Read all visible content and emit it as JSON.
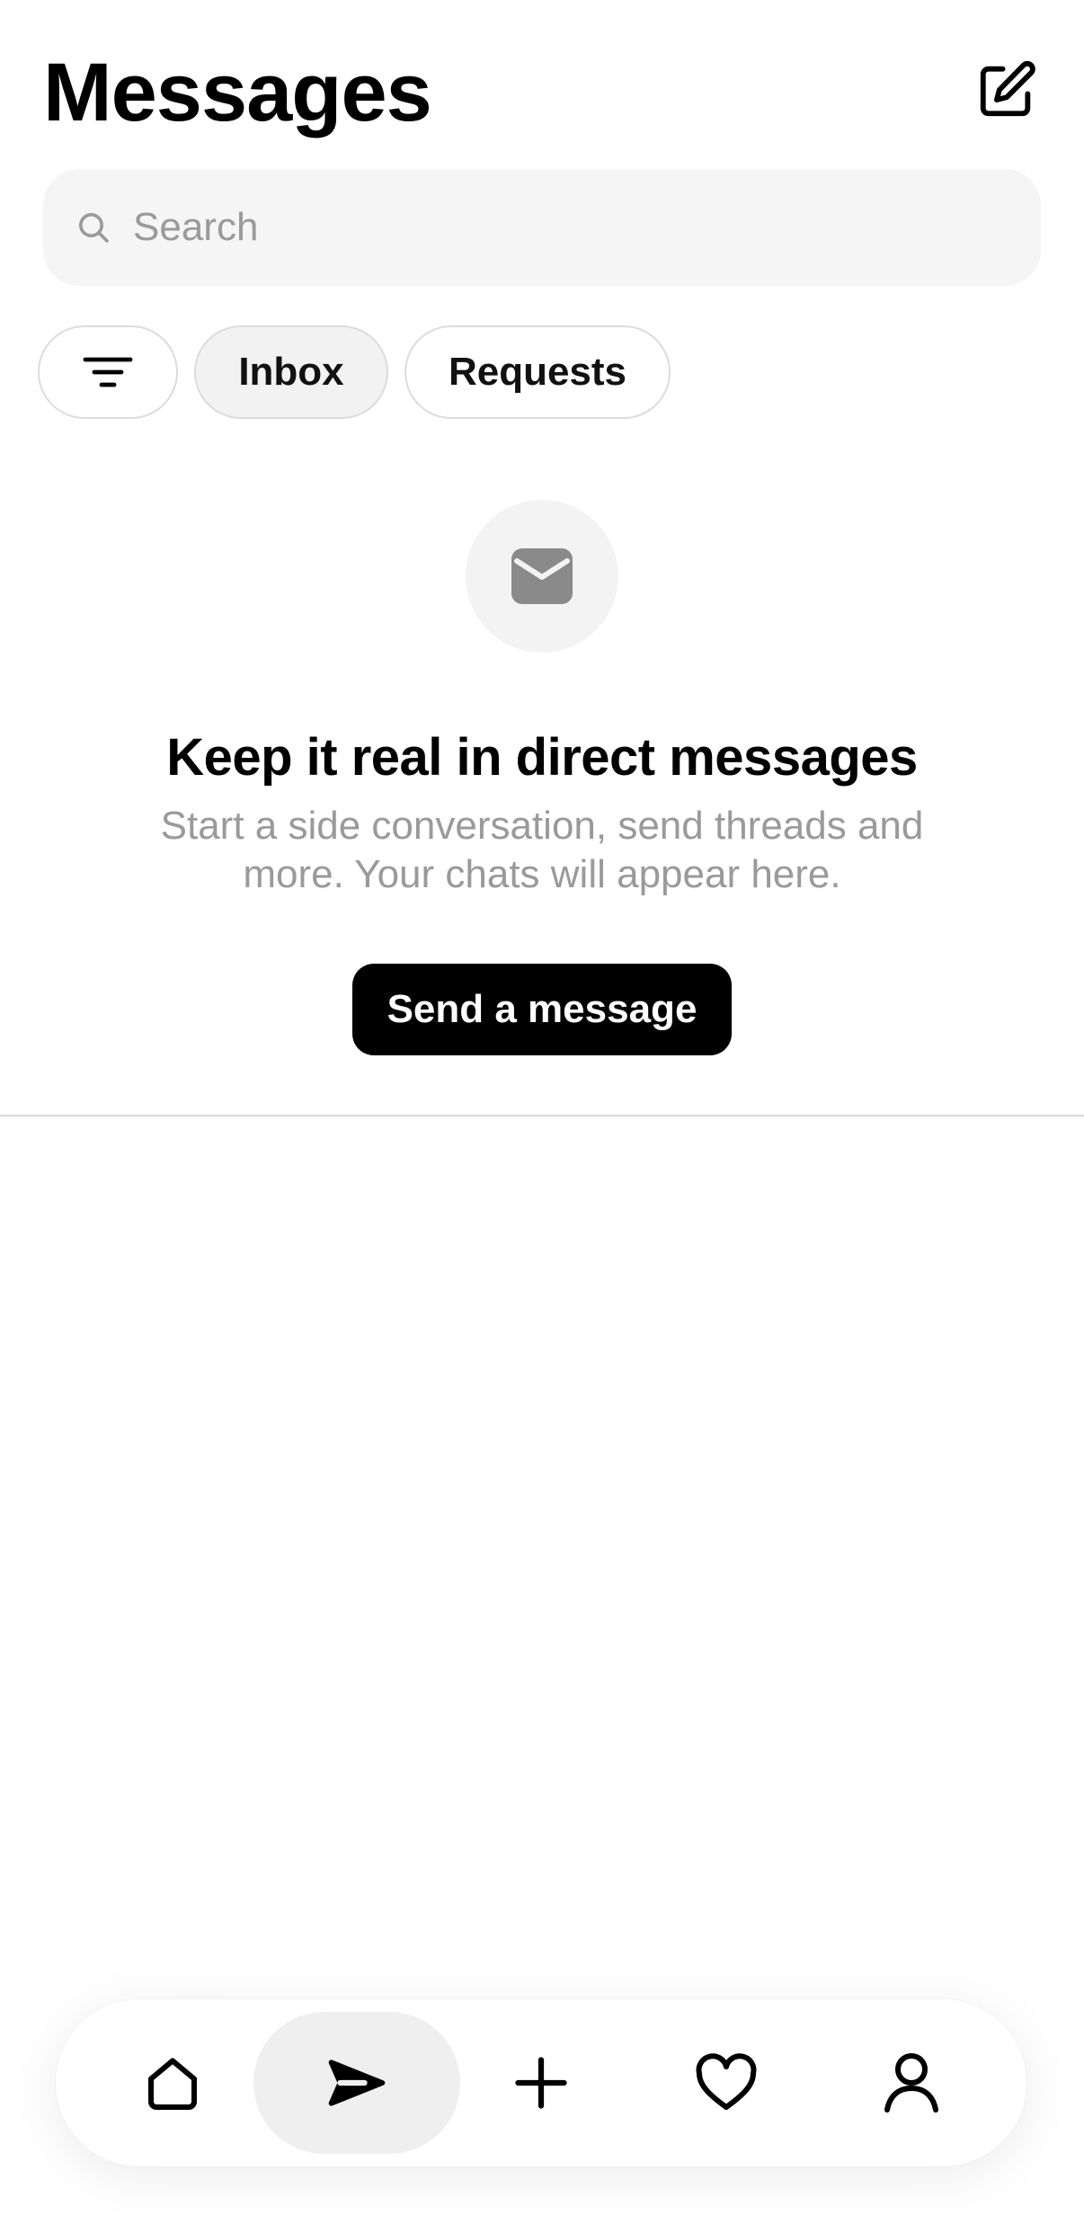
{
  "header": {
    "title": "Messages",
    "compose_icon": "compose-icon"
  },
  "search": {
    "placeholder": "Search",
    "value": "",
    "icon": "search-icon"
  },
  "filters": {
    "filter_icon": "filter-icon",
    "chips": [
      {
        "label": "Inbox",
        "active": true
      },
      {
        "label": "Requests",
        "active": false
      }
    ]
  },
  "empty_state": {
    "icon": "envelope-icon",
    "title": "Keep it real in direct messages",
    "subtitle": "Start a side conversation, send threads and more. Your chats will appear here.",
    "button_label": "Send a message"
  },
  "bottom_nav": {
    "items": [
      {
        "icon": "home-icon",
        "active": false
      },
      {
        "icon": "send-icon",
        "active": true
      },
      {
        "icon": "plus-icon",
        "active": false
      },
      {
        "icon": "heart-icon",
        "active": false
      },
      {
        "icon": "profile-icon",
        "active": false
      }
    ]
  },
  "colors": {
    "background": "#ffffff",
    "search_bg": "#f5f5f5",
    "muted_text": "#9a9a9a",
    "primary_button": "#000000",
    "active_nav_bg": "#efefef"
  }
}
